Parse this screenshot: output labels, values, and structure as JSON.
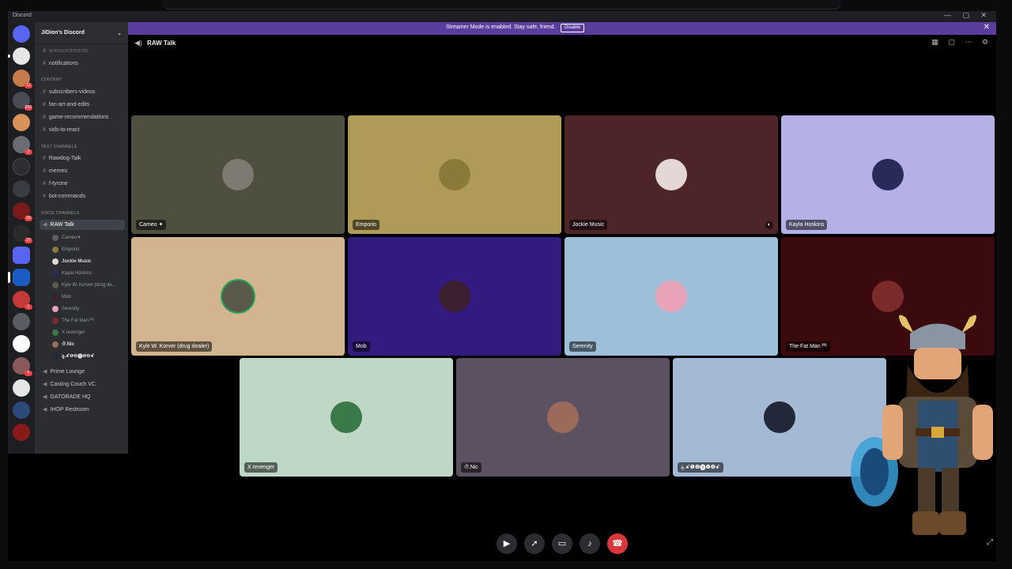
{
  "window": {
    "app_name": "Discord",
    "controls": "— ▢ ✕"
  },
  "banner": {
    "text": "Streamer Mode is enabled. Stay safe, friend.",
    "button": "Disable"
  },
  "server": {
    "name": "JiDion's Discord"
  },
  "channels": {
    "top": [
      {
        "name": "announcements",
        "muted": true
      },
      {
        "name": "notifications",
        "muted": false
      }
    ],
    "category_content": "CONTENT",
    "content": [
      "subscribers-videos",
      "fan-art-and-edits",
      "game-recommendations",
      "vids-to-react"
    ],
    "category_text": "TEXT CHANNELS",
    "text": [
      "Rawdog-Talk",
      "memes",
      "f-tyrone",
      "bot-commands"
    ],
    "category_voice": "VOICE CHANNELS",
    "voice_active": "RAW Talk",
    "voice_users": [
      "Cameo✦",
      "Emporio",
      "Jockie Music",
      "Kayla Hoskins",
      "Kyle W. Korver (drug de...",
      "Mob",
      "Serenity",
      "The Fat Man ᴾᴿ",
      "X revenger",
      "ঔ.Nic",
      "ৡ.ꗃ❶❷⓿❶❷ꗃ"
    ],
    "other_voice": [
      "Prime Lounge",
      "Casting Couch VC",
      "GATORADE HQ",
      "IHOP Restroom"
    ]
  },
  "stage": {
    "title": "RAW Talk"
  },
  "tiles": [
    {
      "name": "Cameo ✦",
      "bg": "#4e4f3f",
      "avatar": "#7d7a72"
    },
    {
      "name": "Emporio",
      "bg": "#b09a58",
      "avatar": "#8a7a3a"
    },
    {
      "name": "Jockie Music",
      "bg": "#4d2528",
      "avatar": "#e5d6d6"
    },
    {
      "name": "Kayla Hoskins",
      "bg": "#b5b0e6",
      "avatar": "#2a2a5a"
    },
    {
      "name": "Kyle W. Korver (drug dealer)",
      "bg": "#d2b48f",
      "avatar": "#5a5a4a"
    },
    {
      "name": "Mob",
      "bg": "#321a7e",
      "avatar": "#3a2030"
    },
    {
      "name": "Serenity",
      "bg": "#9ebfd9",
      "avatar": "#e8a3b8"
    },
    {
      "name": "The Fat Man ᴾᴿ",
      "bg": "#3b0a0c",
      "avatar": "#7a2a2a"
    },
    {
      "name": "X revenger",
      "bg": "#bfd8c6",
      "avatar": "#3a7a4a"
    },
    {
      "name": "ঔ.Nic",
      "bg": "#5c5161",
      "avatar": "#9a6a5a"
    },
    {
      "name": "ৡ.ꗃ❶❷⓿❶❷ꗃ",
      "bg": "#a4b9d4",
      "avatar": "#20283a"
    }
  ],
  "controls": {
    "camera": "camera-icon",
    "activity": "rocket-icon",
    "screen": "screen-share-icon",
    "mic": "mic-icon",
    "leave": "disconnect-icon"
  }
}
